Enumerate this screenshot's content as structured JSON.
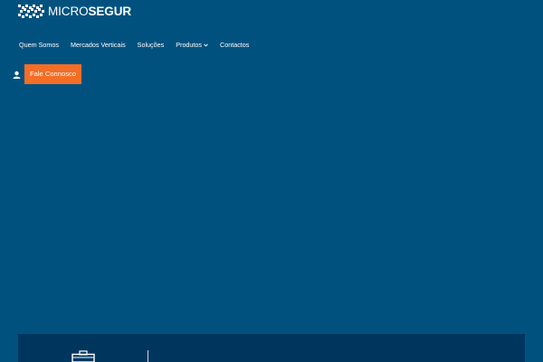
{
  "brand": {
    "name_part1": "MICRO",
    "name_part2": "SEGUR",
    "logo_icon": "checkered-mark-icon"
  },
  "nav": {
    "items": [
      {
        "label": "Quem Somos"
      },
      {
        "label": "Mercados Verticais"
      },
      {
        "label": "Soluções"
      },
      {
        "label": "Produtos",
        "has_dropdown": true
      },
      {
        "label": "Contactos"
      }
    ]
  },
  "header_actions": {
    "user_icon": "user-icon",
    "cta_label": "Fale Connosco"
  },
  "panel": {
    "icon": "briefcase-icon"
  },
  "colors": {
    "background": "#01517f",
    "panel": "#00365e",
    "accent": "#f46e26",
    "text": "#ffffff"
  }
}
